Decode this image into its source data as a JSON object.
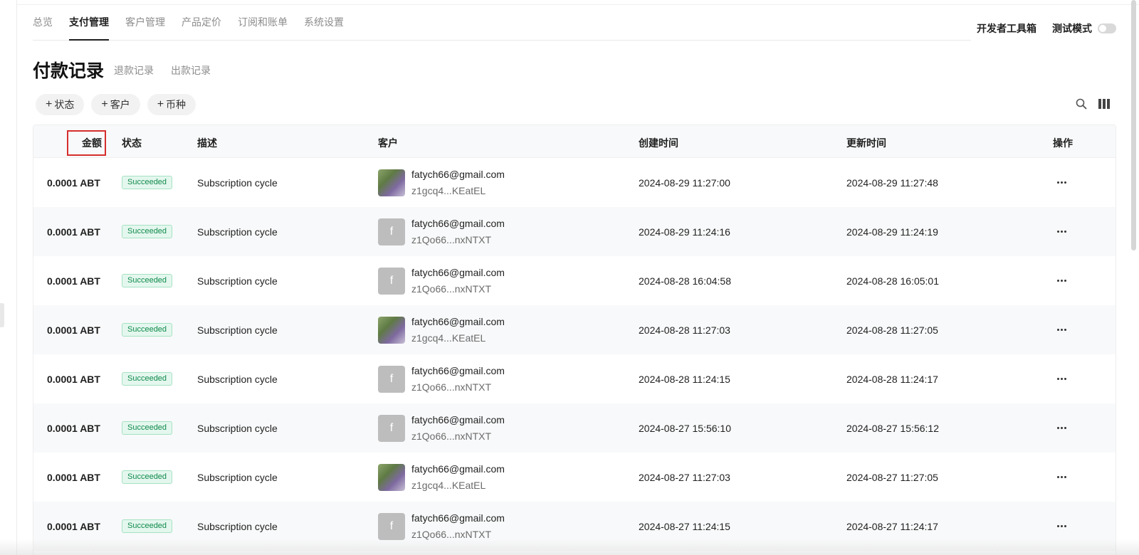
{
  "nav": {
    "tabs": [
      {
        "label": "总览",
        "active": false
      },
      {
        "label": "支付管理",
        "active": true
      },
      {
        "label": "客户管理",
        "active": false
      },
      {
        "label": "产品定价",
        "active": false
      },
      {
        "label": "订阅和账单",
        "active": false
      },
      {
        "label": "系统设置",
        "active": false
      }
    ]
  },
  "header": {
    "dev_tools_label": "开发者工具箱",
    "test_mode_label": "测试模式",
    "test_mode_on": false
  },
  "page": {
    "title": "付款记录",
    "sub_tabs": [
      "退款记录",
      "出款记录"
    ]
  },
  "filters": [
    {
      "plus": "+",
      "label": "状态"
    },
    {
      "plus": "+",
      "label": "客户"
    },
    {
      "plus": "+",
      "label": "币种"
    }
  ],
  "toolbar": {
    "icons": [
      "search-icon",
      "columns-icon"
    ]
  },
  "table": {
    "columns": {
      "amount": "金额",
      "status": "状态",
      "description": "描述",
      "customer": "客户",
      "created": "创建时间",
      "updated": "更新时间",
      "action": "操作"
    },
    "rows": [
      {
        "amount": "0.0001 ABT",
        "status": "Succeeded",
        "description": "Subscription cycle",
        "avatar_type": "photo",
        "avatar_letter": "",
        "email": "fatych66@gmail.com",
        "customer_id": "z1gcq4...KEatEL",
        "created": "2024-08-29 11:27:00",
        "updated": "2024-08-29 11:27:48"
      },
      {
        "amount": "0.0001 ABT",
        "status": "Succeeded",
        "description": "Subscription cycle",
        "avatar_type": "letter",
        "avatar_letter": "f",
        "email": "fatych66@gmail.com",
        "customer_id": "z1Qo66...nxNTXT",
        "created": "2024-08-29 11:24:16",
        "updated": "2024-08-29 11:24:19"
      },
      {
        "amount": "0.0001 ABT",
        "status": "Succeeded",
        "description": "Subscription cycle",
        "avatar_type": "letter",
        "avatar_letter": "f",
        "email": "fatych66@gmail.com",
        "customer_id": "z1Qo66...nxNTXT",
        "created": "2024-08-28 16:04:58",
        "updated": "2024-08-28 16:05:01"
      },
      {
        "amount": "0.0001 ABT",
        "status": "Succeeded",
        "description": "Subscription cycle",
        "avatar_type": "photo",
        "avatar_letter": "",
        "email": "fatych66@gmail.com",
        "customer_id": "z1gcq4...KEatEL",
        "created": "2024-08-28 11:27:03",
        "updated": "2024-08-28 11:27:05"
      },
      {
        "amount": "0.0001 ABT",
        "status": "Succeeded",
        "description": "Subscription cycle",
        "avatar_type": "letter",
        "avatar_letter": "f",
        "email": "fatych66@gmail.com",
        "customer_id": "z1Qo66...nxNTXT",
        "created": "2024-08-28 11:24:15",
        "updated": "2024-08-28 11:24:17"
      },
      {
        "amount": "0.0001 ABT",
        "status": "Succeeded",
        "description": "Subscription cycle",
        "avatar_type": "letter",
        "avatar_letter": "f",
        "email": "fatych66@gmail.com",
        "customer_id": "z1Qo66...nxNTXT",
        "created": "2024-08-27 15:56:10",
        "updated": "2024-08-27 15:56:12"
      },
      {
        "amount": "0.0001 ABT",
        "status": "Succeeded",
        "description": "Subscription cycle",
        "avatar_type": "photo",
        "avatar_letter": "",
        "email": "fatych66@gmail.com",
        "customer_id": "z1gcq4...KEatEL",
        "created": "2024-08-27 11:27:03",
        "updated": "2024-08-27 11:27:05"
      },
      {
        "amount": "0.0001 ABT",
        "status": "Succeeded",
        "description": "Subscription cycle",
        "avatar_type": "letter",
        "avatar_letter": "f",
        "email": "fatych66@gmail.com",
        "customer_id": "z1Qo66...nxNTXT",
        "created": "2024-08-27 11:24:15",
        "updated": "2024-08-27 11:24:17"
      }
    ]
  },
  "colors": {
    "accent": "#1f1f1f",
    "status_success": "#0f8a4c",
    "highlight_box": "#d62e2e"
  }
}
